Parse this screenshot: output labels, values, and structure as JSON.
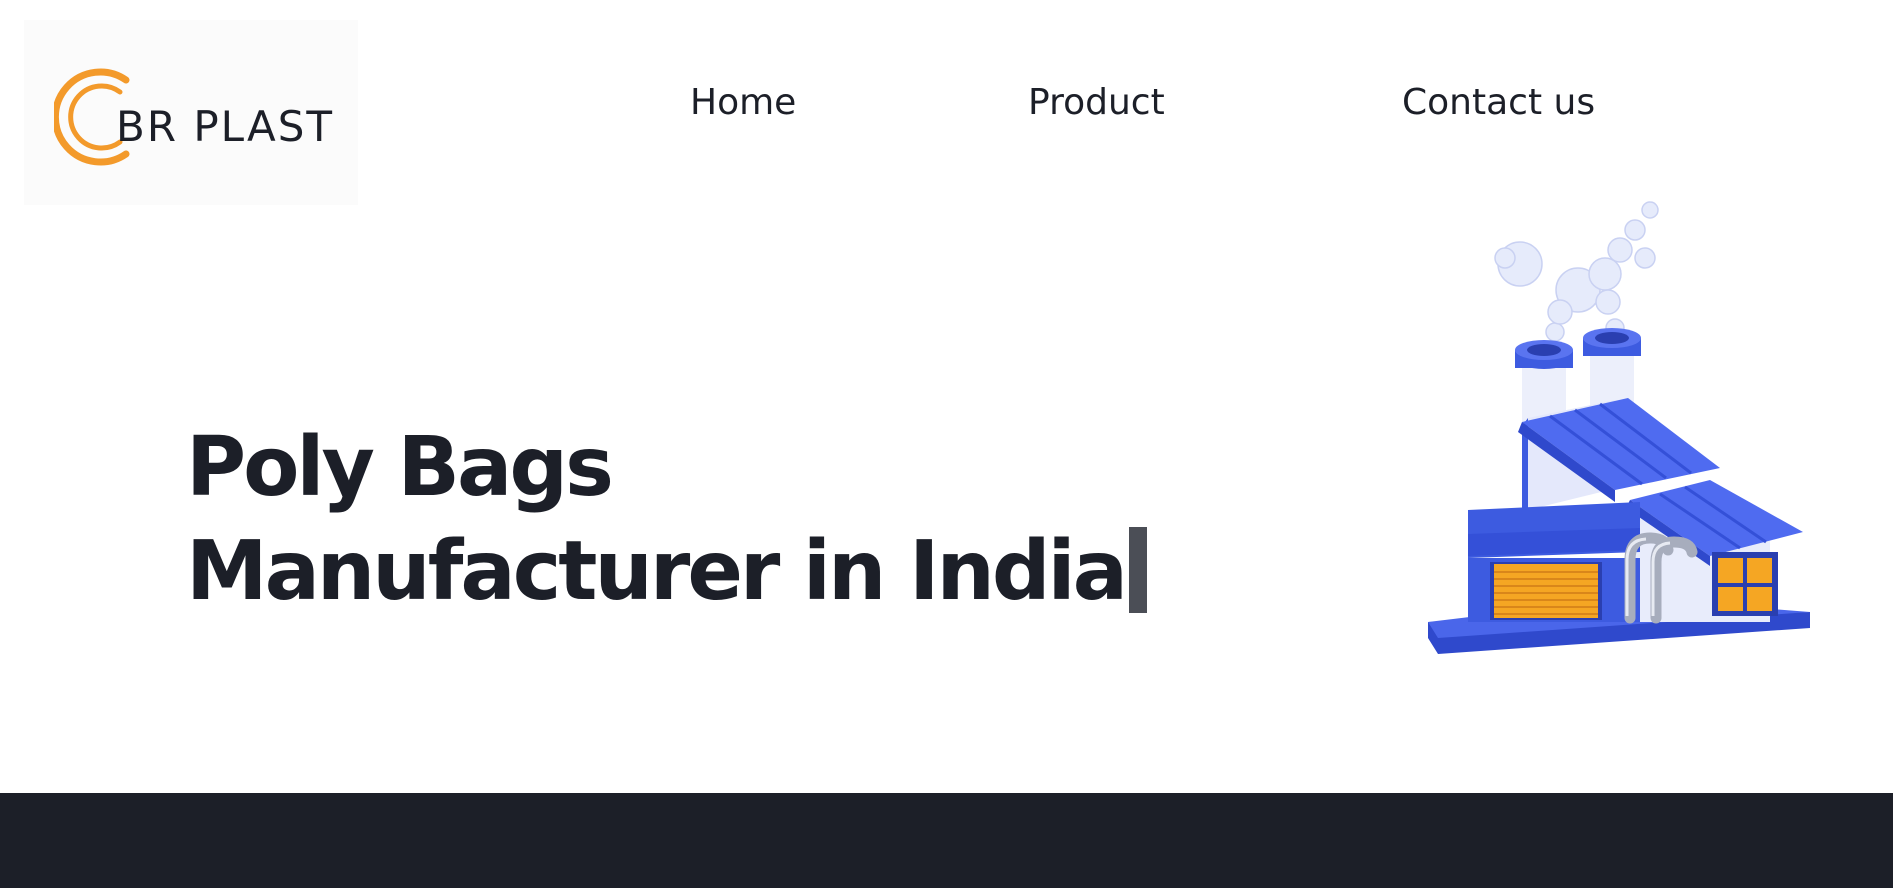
{
  "brand": {
    "logo_text": "BR PLAST",
    "accent_color": "#f39a2b",
    "text_color": "#1c1f28"
  },
  "nav": {
    "items": [
      {
        "label": "Home"
      },
      {
        "label": "Product"
      },
      {
        "label": "Contact us"
      }
    ]
  },
  "hero": {
    "title_line1": "Poly Bags",
    "title_line2": "Manufacturer in India"
  },
  "illustration": {
    "icon": "factory-icon",
    "colors": {
      "building": "#3d5be0",
      "window": "#f5a623",
      "smoke": "#e6ebfb"
    }
  },
  "footer": {
    "color": "#1c1f28"
  }
}
